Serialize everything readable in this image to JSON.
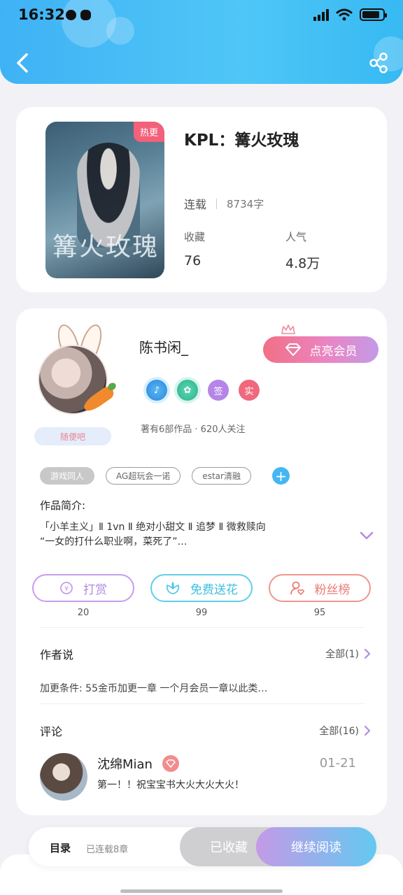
{
  "status_bar": {
    "time": "16:32"
  },
  "book": {
    "cover_title": "篝火玫瑰",
    "hot_badge": "热更",
    "title": "KPL：篝火玫瑰",
    "status": "连载",
    "word_count": "8734字",
    "favorites_label": "收藏",
    "favorites_value": "76",
    "popularity_label": "人气",
    "popularity_value": "4.8万"
  },
  "author": {
    "name": "陈书闲_",
    "vip_button": "点亮会员",
    "decor_badge": "随便吧",
    "badges": [
      "签",
      "实"
    ],
    "meta": "著有6部作品 · 620人关注"
  },
  "tags": [
    "游戏同人",
    "AG超玩会一诺",
    "estar清融"
  ],
  "intro": {
    "label": "作品简介:",
    "line1": "「小羊主义」Ⅱ 1vn Ⅱ 绝对小甜文 Ⅱ 追梦 Ⅱ 微救赎向",
    "line2": "“一女的打什么职业啊，菜死了”…"
  },
  "actions": [
    {
      "label": "打赏",
      "count": "20"
    },
    {
      "label": "免费送花",
      "count": "99"
    },
    {
      "label": "粉丝榜",
      "count": "95"
    }
  ],
  "author_say": {
    "title": "作者说",
    "more": "全部(1)",
    "text": "加更条件: 55金币加更一章 一个月会员一章以此类…"
  },
  "comments": {
    "title": "评论",
    "more": "全部(16)",
    "items": [
      {
        "user": "沈绵Mian",
        "date": "01-21",
        "text": "第一！！祝宝宝书大火大火大火！"
      }
    ]
  },
  "bottom_bar": {
    "toc": "目录",
    "toc_sub": "已连载8章",
    "collected": "已收藏",
    "continue": "继续阅读"
  },
  "colors": {
    "header_blue": "#3fb2f5",
    "vip_pink": "#f26f85",
    "accent_purple": "#c49ae8",
    "accent_cyan": "#63c9f0"
  }
}
